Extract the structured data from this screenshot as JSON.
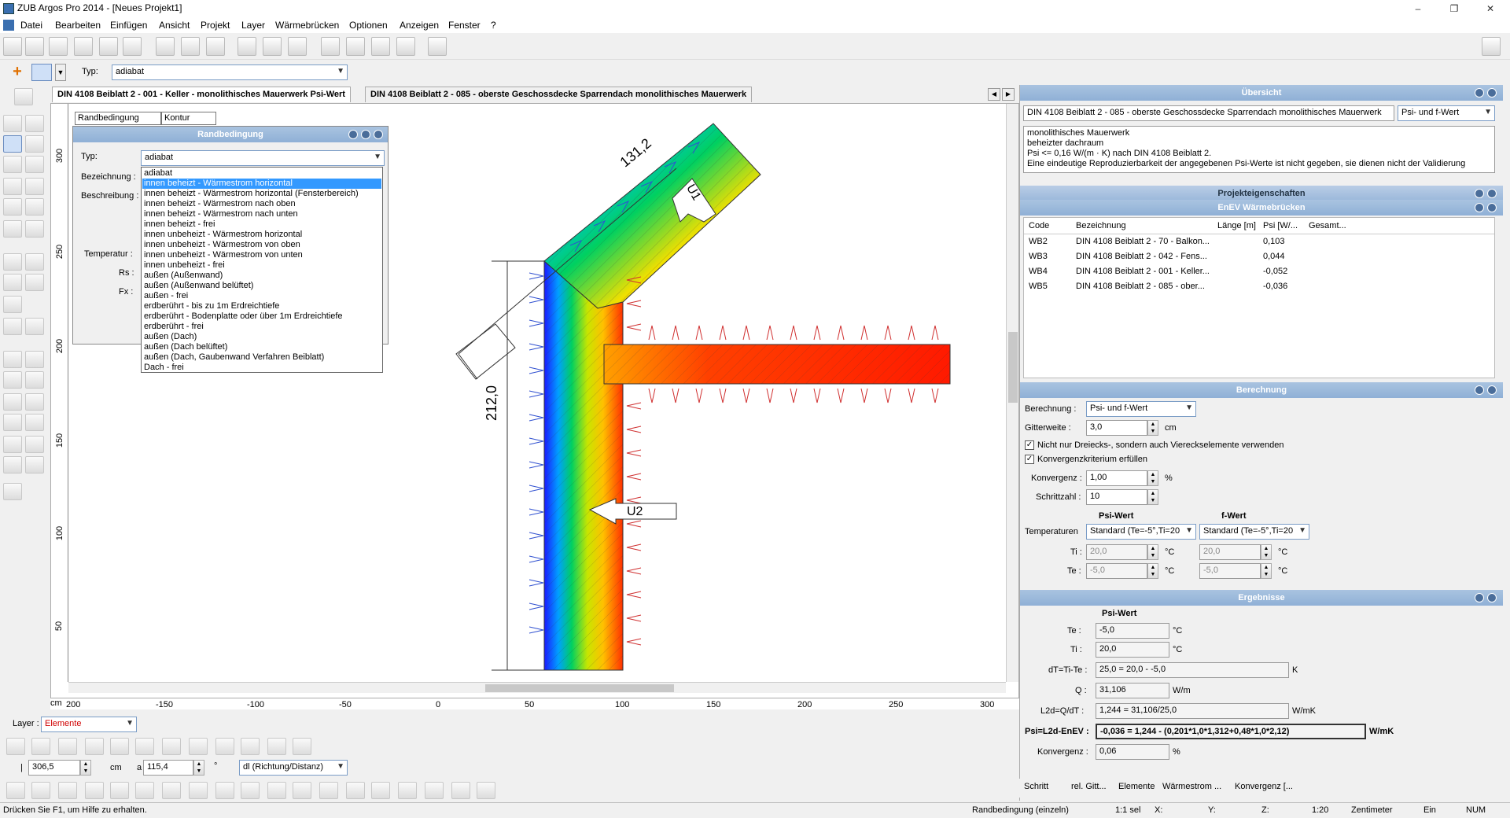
{
  "window": {
    "title": "ZUB Argos Pro 2014 - [Neues Projekt1]"
  },
  "menu": [
    "Datei",
    "Bearbeiten",
    "Einfügen",
    "Ansicht",
    "Projekt",
    "Layer",
    "Wärmebrücken",
    "Optionen",
    "Anzeigen",
    "Fenster",
    "?"
  ],
  "toolbar2": {
    "typ_label": "Typ:",
    "typ_value": "adiabat"
  },
  "tabs": [
    "DIN 4108 Beiblatt 2 - 001 - Keller - monolithisches Mauerwerk Psi-Wert",
    "DIN 4108 Beiblatt 2 - 085 - oberste Geschossdecke Sparrendach monolithisches Mauerwerk"
  ],
  "rb": {
    "subtab1": "Randbedingung",
    "subtab2": "Kontur",
    "title": "Randbedingung",
    "typ_label": "Typ:",
    "typ_value": "adiabat",
    "bez_label": "Bezeichnung :",
    "beschr_label": "Beschreibung :",
    "temp_label": "Temperatur :",
    "rs_label": "Rs :",
    "fx_label": "Fx :",
    "options": [
      "adiabat",
      "innen beheizt - Wärmestrom horizontal",
      "innen beheizt - Wärmestrom horizontal (Fensterbereich)",
      "innen beheizt - Wärmestrom nach oben",
      "innen beheizt - Wärmestrom nach unten",
      "innen beheizt - frei",
      "innen unbeheizt - Wärmestrom horizontal",
      "innen unbeheizt - Wärmestrom von oben",
      "innen unbeheizt - Wärmestrom von unten",
      "innen unbeheizt - frei",
      "außen (Außenwand)",
      "außen (Außenwand belüftet)",
      "außen - frei",
      "erdberührt - bis zu 1m Erdreichtiefe",
      "erdberührt - Bodenplatte oder über 1m Erdreichtiefe",
      "erdberührt - frei",
      "außen (Dach)",
      "außen (Dach belüftet)",
      "außen (Dach, Gaubenwand Verfahren Beiblatt)",
      "Dach - frei"
    ],
    "selected_index": 1
  },
  "drawing": {
    "dim_top": "131,2",
    "dim_left": "212,0",
    "label_u1": "U1",
    "label_u2": "U2",
    "ruler_unit": "cm",
    "ruler_x": [
      "200",
      "-150",
      "-100",
      "-50",
      "0",
      "50",
      "100",
      "150",
      "200",
      "250",
      "300"
    ],
    "ruler_y": [
      "300",
      "250",
      "200",
      "150",
      "100",
      "50"
    ]
  },
  "bottomleft": {
    "layer_label": "Layer :",
    "layer_value": "Elemente",
    "x_value": "306,5",
    "x_unit": "cm",
    "a_value": "115,4",
    "a_unit": "°",
    "mode_value": "dl (Richtung/Distanz)"
  },
  "overview": {
    "header": "Übersicht",
    "name": "DIN 4108 Beiblatt 2 - 085 - oberste Geschossdecke Sparrendach monolithisches Mauerwerk",
    "mode": "Psi- und f-Wert",
    "desc": [
      "monolithisches Mauerwerk",
      "beheizter dachraum",
      "Psi <= 0,16 W/(m · K) nach DIN 4108 Beiblatt 2.",
      "Eine eindeutige Reproduzierbarkeit der angegebenen Psi-Werte ist nicht gegeben, sie dienen nicht der Validierung"
    ]
  },
  "projekt_header": "Projekteigenschaften",
  "enev": {
    "header": "EnEV Wärmebrücken",
    "columns": [
      "Code",
      "Bezeichnung",
      "Länge [m]",
      "Psi [W/...",
      "Gesamt..."
    ],
    "rows": [
      [
        "WB2",
        "DIN 4108 Beiblatt 2 - 70 - Balkon...",
        "",
        "0,103",
        ""
      ],
      [
        "WB3",
        "DIN 4108 Beiblatt 2 - 042 - Fens...",
        "",
        "0,044",
        ""
      ],
      [
        "WB4",
        "DIN 4108 Beiblatt 2 - 001 - Keller...",
        "",
        "-0,052",
        ""
      ],
      [
        "WB5",
        "DIN 4108 Beiblatt 2 - 085 - ober...",
        "",
        "-0,036",
        ""
      ]
    ]
  },
  "berechnung": {
    "header": "Berechnung",
    "ber_label": "Berechnung :",
    "ber_value": "Psi- und f-Wert",
    "gitter_label": "Gitterweite :",
    "gitter_value": "3,0",
    "gitter_unit": "cm",
    "chk1": "Nicht nur Dreiecks-, sondern auch Viereckselemente verwenden",
    "chk2": "Konvergenzkriterium erfüllen",
    "konv_label": "Konvergenz :",
    "konv_value": "1,00",
    "konv_unit": "%",
    "schritt_label": "Schrittzahl :",
    "schritt_value": "10",
    "psi_head": "Psi-Wert",
    "f_head": "f-Wert",
    "temp_label": "Temperaturen",
    "temp_psi": "Standard (Te=-5°,Ti=20",
    "temp_f": "Standard (Te=-5°,Ti=20",
    "ti_label": "Ti :",
    "te_label": "Te :",
    "ti_psi": "20,0",
    "te_psi": "-5,0",
    "ti_f": "20,0",
    "te_f": "-5,0",
    "unit_c": "°C"
  },
  "ergebnisse": {
    "header": "Ergebnisse",
    "psi_head": "Psi-Wert",
    "te_label": "Te :",
    "te_value": "-5,0",
    "ti_label": "Ti :",
    "ti_value": "20,0",
    "dt_label": "dT=Ti-Te :",
    "dt_value": "25,0 = 20,0 - -5,0",
    "dt_unit": "K",
    "q_label": "Q :",
    "q_value": "31,106",
    "q_unit": "W/m",
    "l2d_label": "L2d=Q/dT :",
    "l2d_value": "1,244 = 31,106/25,0",
    "l2d_unit": "W/mK",
    "psi_label": "Psi=L2d-EnEV :",
    "psi_value": "-0,036 = 1,244 - (0,201*1,0*1,312+0,48*1,0*2,12)",
    "psi_unit": "W/mK",
    "konv_label": "Konvergenz :",
    "konv_value": "0,06",
    "konv_unit": "%",
    "unit_c": "°C"
  },
  "bottomtabs": [
    "Schritt",
    "rel. Gitt...",
    "Elemente",
    "Wärmestrom ...",
    "Konvergenz [..."
  ],
  "status": {
    "help": "Drücken Sie F1, um Hilfe zu erhalten.",
    "mode": "Randbedingung (einzeln)",
    "sel": "1:1 sel",
    "x": "X:",
    "y": "Y:",
    "z": "Z:",
    "scale": "1:20",
    "unit": "Zentimeter",
    "ein": "Ein",
    "num": "NUM"
  }
}
